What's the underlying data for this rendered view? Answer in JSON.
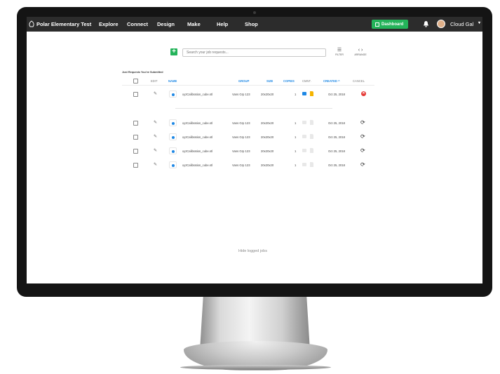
{
  "navbar": {
    "brand": "Polar Elementary Test",
    "links": [
      "Explore",
      "Connect",
      "Design",
      "Make",
      "Help",
      "Shop"
    ],
    "dashboard_label": "Dashboard",
    "user_name": "Cloud Gal",
    "caret": "▾"
  },
  "toolbar": {
    "add_symbol": "+",
    "search_placeholder": "Search your job requests...",
    "filter_label": "FILTER",
    "arrows_label": "ARRANGE"
  },
  "section_title": "Just Requests You've Submitted",
  "columns": {
    "edit": "EDIT",
    "name": "NAME",
    "group": "GROUP",
    "size": "SIZE",
    "copies": "COPIES",
    "cmnt": "CMNT.",
    "created": "CREATED ^",
    "cancel": "CANCEL"
  },
  "rows": [
    {
      "name": "xyzCalibration_cube.stl",
      "group": "Vans Grp 123",
      "size": "20x20x20",
      "copies": "1",
      "created": "Oct 25, 2018",
      "status": "cancel"
    },
    {
      "name": "xyzCalibration_cube.stl",
      "group": "Vans Grp 123",
      "size": "20x20x20",
      "copies": "1",
      "created": "Oct 25, 2018",
      "status": "refresh"
    },
    {
      "name": "xyzCalibration_cube.stl",
      "group": "Vans Grp 123",
      "size": "20x20x20",
      "copies": "1",
      "created": "Oct 25, 2018",
      "status": "refresh"
    },
    {
      "name": "xyzCalibration_cube.stl",
      "group": "Vans Grp 123",
      "size": "20x20x20",
      "copies": "1",
      "created": "Oct 25, 2018",
      "status": "refresh"
    },
    {
      "name": "xyzCalibration_cube.stl",
      "group": "Vans Grp 123",
      "size": "20x20x20",
      "copies": "1",
      "created": "Oct 25, 2018",
      "status": "refresh"
    }
  ],
  "icons": {
    "edit": "✎",
    "refresh": "⟳",
    "cancel": "✕",
    "filter": "☰",
    "arrows": "‹ ›"
  },
  "footer_link": "Hide logged jobs",
  "colors": {
    "accent_green": "#24b35a",
    "accent_blue": "#1e88e5",
    "cancel_red": "#e53935",
    "navbar": "#2c2c2c"
  }
}
